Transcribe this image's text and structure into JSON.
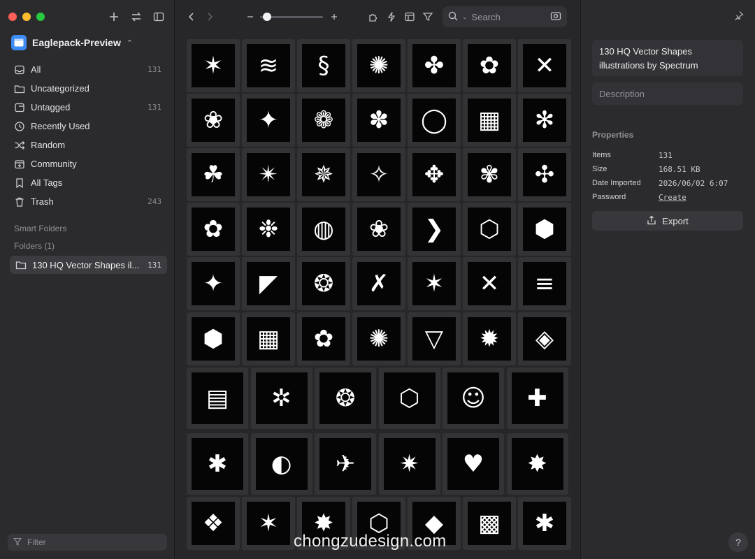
{
  "sidebar": {
    "library_name": "Eaglepack-Preview",
    "nav": [
      {
        "label": "All",
        "count": "131",
        "icon": "inbox-icon"
      },
      {
        "label": "Uncategorized",
        "count": "",
        "icon": "folder-icon"
      },
      {
        "label": "Untagged",
        "count": "131",
        "icon": "tag-icon"
      },
      {
        "label": "Recently Used",
        "count": "",
        "icon": "clock-icon"
      },
      {
        "label": "Random",
        "count": "",
        "icon": "shuffle-icon"
      },
      {
        "label": "Community",
        "count": "",
        "icon": "tray-icon"
      },
      {
        "label": "All Tags",
        "count": "",
        "icon": "bookmark-icon"
      },
      {
        "label": "Trash",
        "count": "243",
        "icon": "trash-icon"
      }
    ],
    "smart_folders_title": "Smart Folders",
    "folders_title": "Folders (1)",
    "folder": {
      "label": "130 HQ Vector Shapes il...",
      "count": "131"
    },
    "filter_placeholder": "Filter"
  },
  "toolbar": {
    "search_placeholder": "Search",
    "zoom_level": 0.05
  },
  "grid": {
    "glyphs": [
      [
        "✶",
        "≋",
        "§",
        "✺",
        "✤",
        "✿",
        "✕"
      ],
      [
        "❀",
        "✦",
        "❁",
        "✽",
        "◯",
        "▦",
        "✻"
      ],
      [
        "☘",
        "✴",
        "✵",
        "✧",
        "✥",
        "✾",
        "✣"
      ],
      [
        "✿",
        "❉",
        "◍",
        "❀",
        "❯",
        "⬡",
        "⬢"
      ],
      [
        "✦",
        "◤",
        "❂",
        "✗",
        "✶",
        "✕",
        "≡"
      ],
      [
        "⬢",
        "▦",
        "✿",
        "✺",
        "▽",
        "✹",
        "◈"
      ],
      [
        "▤",
        "✲",
        "❂",
        "⬡",
        "☺",
        "✚"
      ],
      [
        "✱",
        "◐",
        "✈",
        "✷",
        "♥",
        "✸"
      ],
      [
        "❖",
        "✶",
        "✸",
        "⬡",
        "◆",
        "▩",
        "✱"
      ]
    ]
  },
  "inspector": {
    "name": "130 HQ Vector Shapes illustrations by Spectrum",
    "description_placeholder": "Description",
    "properties_title": "Properties",
    "properties": [
      {
        "label": "Items",
        "value": "131"
      },
      {
        "label": "Size",
        "value": "168.51 KB"
      },
      {
        "label": "Date Imported",
        "value": "2026/06/02 6:07"
      },
      {
        "label": "Password",
        "value": "Create"
      }
    ],
    "export_label": "Export"
  },
  "watermark": "chongzudesign.com",
  "help_label": "?"
}
